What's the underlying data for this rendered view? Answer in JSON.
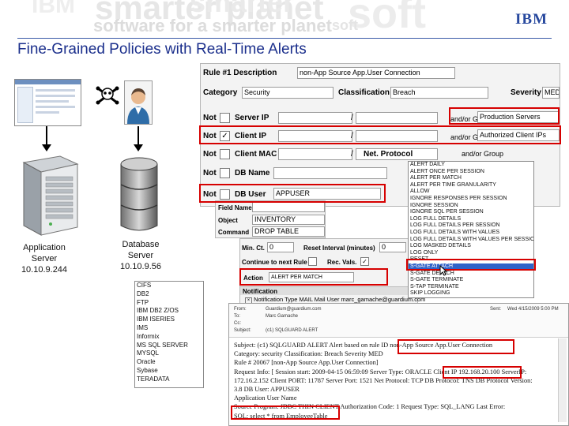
{
  "banner": {
    "words": [
      "smarter planet",
      "software for a smarter planet",
      "soft",
      "IBM",
      "soft",
      "smarter"
    ],
    "logo": "IBM"
  },
  "title": "Fine-Grained Policies with Real-Time Alerts",
  "left": {
    "app_server_label": "Application\nServer\n10.10.9.244",
    "db_server_label": "Database\nServer\n10.10.9.56",
    "skull_icon": "skull-crossbones-icon",
    "user_icon": "person-icon"
  },
  "rule": {
    "title": "Rule #1 Description",
    "description": "non-App Source App.User Connection",
    "category_label": "Category",
    "category": "Security",
    "classification_label": "Classification",
    "classification": "Breach",
    "severity_label": "Severity",
    "severity": "MED",
    "rows": [
      {
        "not": "Not",
        "label": "Server IP",
        "slash": "/",
        "andor": "and/or Group",
        "group": "Production Servers"
      },
      {
        "not": "Not",
        "label": "Client IP",
        "slash": "/",
        "andor": "and/or Group",
        "group": "Authorized Client IPs"
      },
      {
        "not": "Not",
        "label": "Client MAC",
        "slash": "/",
        "andor": "and/or Group",
        "net": "Net. Protocol"
      },
      {
        "not": "Not",
        "label": "DB Name"
      },
      {
        "not": "Not",
        "label": "DB User",
        "value": "APPUSER"
      }
    ],
    "field_name_label": "Field Name",
    "object_label": "Object",
    "object": "INVENTORY",
    "command_label": "Command",
    "command": "DROP TABLE",
    "min_ct_label": "Min. Ct.",
    "min_ct": "0",
    "reset_label": "Reset Interval (minutes)",
    "reset": "0",
    "continue_label": "Continue to next Rule",
    "rec_vals_label": "Rec. Vals.",
    "action_label": "Action",
    "action": "ALERT PER MATCH",
    "notification_label": "Notification",
    "notification_text": "Notification Type MAIL Mail User marc_gamache@guardium.com"
  },
  "action_options": [
    "ALERT DAILY",
    "ALERT ONCE PER SESSION",
    "ALERT PER MATCH",
    "ALERT PER TIME GRANULARITY",
    "ALLOW",
    "IGNORE RESPONSES PER SESSION",
    "IGNORE SESSION",
    "IGNORE SQL PER SESSION",
    "LOG FULL DETAILS",
    "LOG FULL DETAILS PER SESSION",
    "LOG FULL DETAILS WITH VALUES",
    "LOG FULL DETAILS WITH VALUES PER SESSION",
    "LOG MASKED DETAILS",
    "LOG ONLY",
    "RESET",
    "S-GATE ATTACH",
    "S-GATE DETACH",
    "S-GATE TERMINATE",
    "S-TAP TERMINATE",
    "SKIP LOGGING"
  ],
  "action_selected_index": 15,
  "db_types": [
    "CIFS",
    "DB2",
    "FTP",
    "IBM DB2 Z/OS",
    "IBM ISERIES",
    "IMS",
    "Informix",
    "MS SQL SERVER",
    "MYSQL",
    "Oracle",
    "Sybase",
    "TERADATA"
  ],
  "email": {
    "from_label": "From:",
    "from": "Guardium@guardium.com",
    "to_label": "To:",
    "to": "Marc Gamache",
    "cc_label": "Cc:",
    "cc": "",
    "subject_label": "Subject:",
    "subject": "(c1) SQLGUARD ALERT",
    "sent_label": "Sent:",
    "sent": "Wed 4/15/2009 5:00 PM",
    "body": [
      "Subject: (c1) SQLGUARD ALERT Alert based on rule ID non-App Source App.User Connection",
      "Category: security Classification: Breach Severity MED",
      "Rule # 20067 [non-App Source App.User Connection]",
      "Request Info: [ Session start: 2009-04-15 06:59:09 Server Type: ORACLE Client IP 192.168.20.100 ServerIP:",
      "172.16.2.152 Client PORT: 11787 Server Port: 1521 Net Protocol: TCP DB Protocol: TNS DB Protocol Version:",
      "3.8 DB User: APPUSER",
      "Application User Name",
      "Source Program: JDBC THIN CLIENT Authorization Code: 1 Request Type: SQL_LANG Last Error:",
      "SQL: select * from EmployeeTable"
    ]
  },
  "colors": {
    "title": "#1b2f8c",
    "highlight": "#d60000",
    "selection": "#3062c8"
  }
}
